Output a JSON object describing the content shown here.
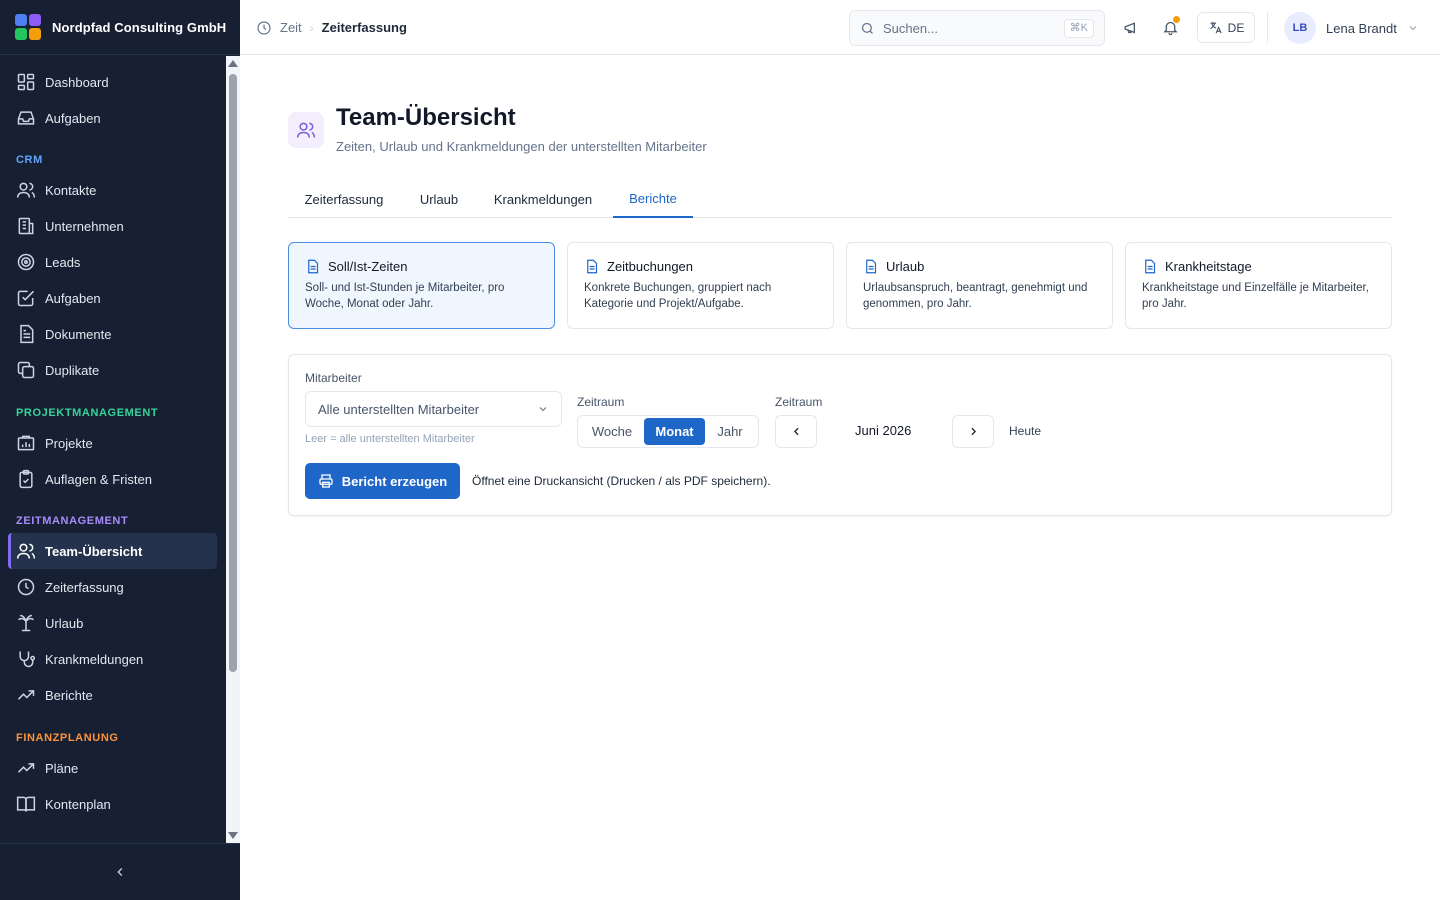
{
  "brand": {
    "name": "Nordpfad Consulting GmbH",
    "logo_colors": [
      "#4f7ff0",
      "#8b5cf6",
      "#22c55e",
      "#f59e0b"
    ]
  },
  "sidebar": {
    "top_items": [
      {
        "label": "Dashboard",
        "icon": "dashboard-icon"
      },
      {
        "label": "Aufgaben",
        "icon": "inbox-icon"
      }
    ],
    "sections": [
      {
        "label": "CRM",
        "color": "#60a5fa",
        "items": [
          {
            "label": "Kontakte",
            "icon": "users-icon"
          },
          {
            "label": "Unternehmen",
            "icon": "building-icon"
          },
          {
            "label": "Leads",
            "icon": "target-icon"
          },
          {
            "label": "Aufgaben",
            "icon": "checkbox-icon"
          },
          {
            "label": "Dokumente",
            "icon": "document-icon"
          },
          {
            "label": "Duplikate",
            "icon": "copy-icon"
          }
        ]
      },
      {
        "label": "PROJEKTMANAGEMENT",
        "color": "#34d399",
        "items": [
          {
            "label": "Projekte",
            "icon": "folder-icon"
          },
          {
            "label": "Auflagen & Fristen",
            "icon": "clipboard-icon"
          }
        ]
      },
      {
        "label": "ZEITMANAGEMENT",
        "color": "#a78bfa",
        "items": [
          {
            "label": "Team-Übersicht",
            "icon": "team-icon",
            "active": true
          },
          {
            "label": "Zeiterfassung",
            "icon": "clock-icon"
          },
          {
            "label": "Urlaub",
            "icon": "palm-tree-icon"
          },
          {
            "label": "Krankmeldungen",
            "icon": "stethoscope-icon"
          },
          {
            "label": "Berichte",
            "icon": "trend-icon"
          }
        ]
      },
      {
        "label": "FINANZPLANUNG",
        "color": "#fb923c",
        "items": [
          {
            "label": "Pläne",
            "icon": "trend-icon"
          },
          {
            "label": "Kontenplan",
            "icon": "book-icon"
          }
        ]
      }
    ]
  },
  "header": {
    "breadcrumb": [
      "Zeit",
      "Zeiterfassung"
    ],
    "search_placeholder": "Suchen...",
    "search_shortcut": "⌘K",
    "language": "DE",
    "user_initials": "LB",
    "user_name": "Lena Brandt"
  },
  "page": {
    "title": "Team-Übersicht",
    "subtitle": "Zeiten, Urlaub und Krankmeldungen der unterstellten Mitarbeiter",
    "tabs": [
      "Zeiterfassung",
      "Urlaub",
      "Krankmeldungen",
      "Berichte"
    ],
    "active_tab": "Berichte"
  },
  "reports": [
    {
      "title": "Soll/Ist-Zeiten",
      "desc": "Soll- und Ist-Stunden je Mitarbeiter, pro Woche, Monat oder Jahr.",
      "selected": true
    },
    {
      "title": "Zeitbuchungen",
      "desc": "Konkrete Buchungen, gruppiert nach Kategorie und Projekt/Aufgabe.",
      "selected": false
    },
    {
      "title": "Urlaub",
      "desc": "Urlaubsanspruch, beantragt, genehmigt und genommen, pro Jahr.",
      "selected": false
    },
    {
      "title": "Krankheitstage",
      "desc": "Krankheitstage und Einzelfälle je Mitarbeiter, pro Jahr.",
      "selected": false
    }
  ],
  "form": {
    "employee_label": "Mitarbeiter",
    "employee_value": "Alle unterstellten Mitarbeiter",
    "employee_hint": "Leer = alle unterstellten Mitarbeiter",
    "range_label": "Zeitraum",
    "range_options": [
      "Woche",
      "Monat",
      "Jahr"
    ],
    "range_selected": "Monat",
    "period_label": "Zeitraum",
    "period_value": "Juni 2026",
    "today_label": "Heute",
    "generate_label": "Bericht erzeugen",
    "generate_note": "Öffnet eine Druckansicht (Drucken / als PDF speichern)."
  },
  "colors": {
    "sidebar_bg": "#172033",
    "accent": "#1e66c8",
    "active_marker": "#7c6cf0"
  }
}
